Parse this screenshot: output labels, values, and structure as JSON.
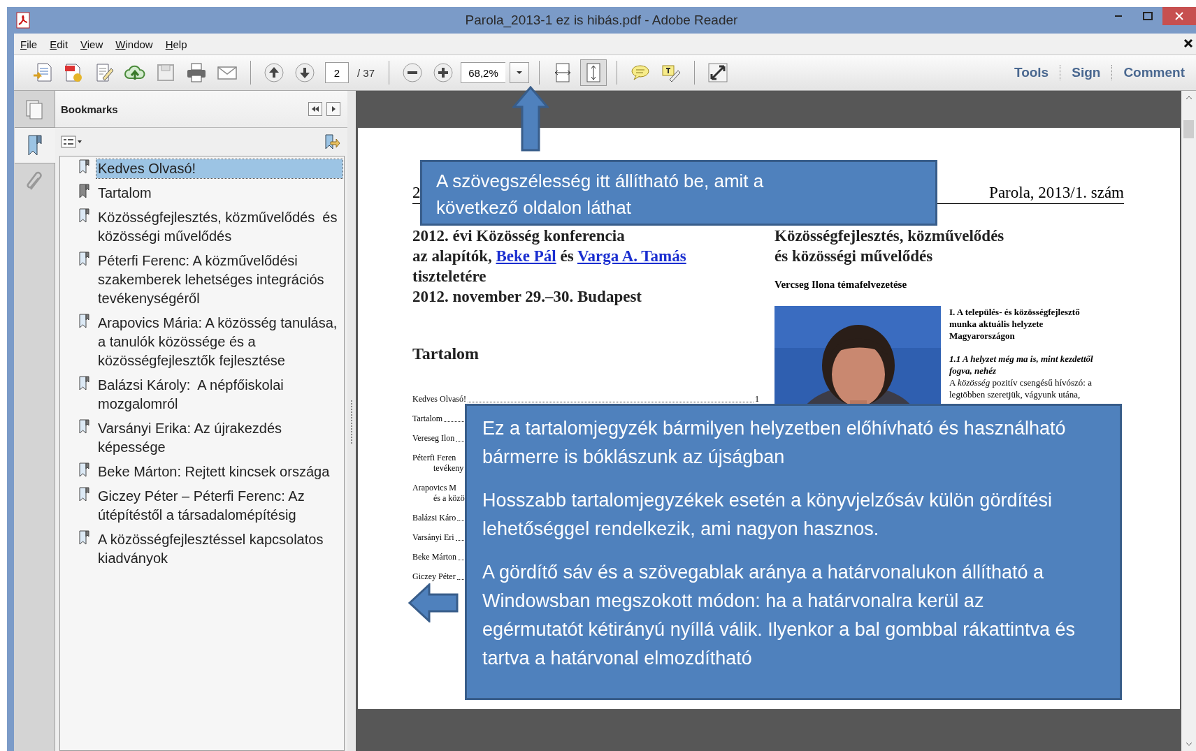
{
  "window": {
    "title": "Parola_2013-1 ez is hibás.pdf - Adobe Reader"
  },
  "menu": [
    {
      "label": "File"
    },
    {
      "label": "Edit"
    },
    {
      "label": "View"
    },
    {
      "label": "Window"
    },
    {
      "label": "Help"
    }
  ],
  "toolbar": {
    "page": "2",
    "page_count": "/ 37",
    "zoom": "68,2%",
    "panels": [
      "Tools",
      "Sign",
      "Comment"
    ]
  },
  "bookmarks": {
    "title": "Bookmarks",
    "items": [
      {
        "label": "Kedves Olvasó!",
        "selected": true
      },
      {
        "label": "Tartalom",
        "selected": false
      },
      {
        "label": "Közösségfejlesztés, közművelődés  és közösségi művelődés",
        "selected": false
      },
      {
        "label": "Péterfi Ferenc: A közművelődési szakemberek lehetséges integrációs tevékenységéről",
        "selected": false
      },
      {
        "label": "Arapovics Mária: A közösség tanulása, a tanulók közössége és a közösségfejlesztők fejlesztése",
        "selected": false
      },
      {
        "label": "Balázsi Károly:  A népfőiskolai mozgalomról",
        "selected": false
      },
      {
        "label": "Varsányi Erika: Az újrakezdés képessége",
        "selected": false
      },
      {
        "label": "Beke Márton: Rejtett kincsek országa",
        "selected": false
      },
      {
        "label": "Giczey Péter – Péterfi Ferenc: Az útépítéstől a társadalomépítésig",
        "selected": false
      },
      {
        "label": "A közösségfejlesztéssel kapcsolatos kiadványok",
        "selected": false
      }
    ]
  },
  "document": {
    "header": {
      "page_number": "2",
      "journal": "Parola, 2013/1. szám"
    },
    "left": {
      "heading": [
        [
          {
            "text": "2012. évi Közösség konferencia"
          }
        ],
        [
          {
            "text": "az alapítók, "
          },
          {
            "text": "Beke Pál",
            "link": true
          },
          {
            "text": " és "
          },
          {
            "text": "Varga A. Tamás",
            "link": true
          }
        ],
        [
          {
            "text": "tiszteletére"
          }
        ],
        [
          {
            "text": "2012. november 29.–30. Budapest"
          }
        ]
      ],
      "toc_title": "Tartalom",
      "toc": [
        {
          "lines": [
            "Kedves Olvasó!"
          ],
          "page": "1"
        },
        {
          "lines": [
            "Tartalom"
          ]
        },
        {
          "lines": [
            "Vereseg Ilon"
          ]
        },
        {
          "lines": [
            "Péterfi Feren",
            "tevékeny"
          ]
        },
        {
          "lines": [
            "Arapovics M",
            "és a közö"
          ]
        },
        {
          "lines": [
            "Balázsi Káro"
          ]
        },
        {
          "lines": [
            "Varsányi Eri"
          ]
        },
        {
          "lines": [
            "Beke Márton"
          ]
        },
        {
          "lines": [
            "Giczey Péter"
          ]
        }
      ]
    },
    "right": {
      "title_lines": [
        "Közösségfejlesztés, közművelődés",
        "és közösségi művelődés"
      ],
      "byline": "Vercseg Ilona témafelvezetése",
      "photo": {
        "kind": "picture"
      },
      "section": "I. A település- és közösségfejlesztő munka aktuális helyzete Magyarországon",
      "subsection": "1.1 A helyzet még ma is, mint kezdettől fogva, nehéz",
      "body": "A *közösség* pozitív csengésű hívószó: a legtöbben szeretjük, vágyunk utána,"
    }
  },
  "callouts": [
    {
      "kind": "top",
      "paragraphs": [
        "A szövegszélesség itt állítható be, amit a következő oldalon láthat"
      ]
    },
    {
      "kind": "bottom",
      "paragraphs": [
        "Ez a tartalomjegyzék bármilyen helyzetben előhívható és használható bármerre is bóklászunk az újságban",
        "Hosszabb tartalomjegyzékek esetén a könyvjelzősáv külön gördítési lehetőséggel rendelkezik, ami nagyon hasznos.",
        "A gördítő sáv és a szövegablak aránya a határvonalukon állítható a Windowsban megszokott módon: ha a határvonalra kerül az egérmutatót kétirányú nyíllá válik. Ilyenkor a bal gombbal rákattintva és tartva a határvonal elmozdítható"
      ]
    }
  ]
}
